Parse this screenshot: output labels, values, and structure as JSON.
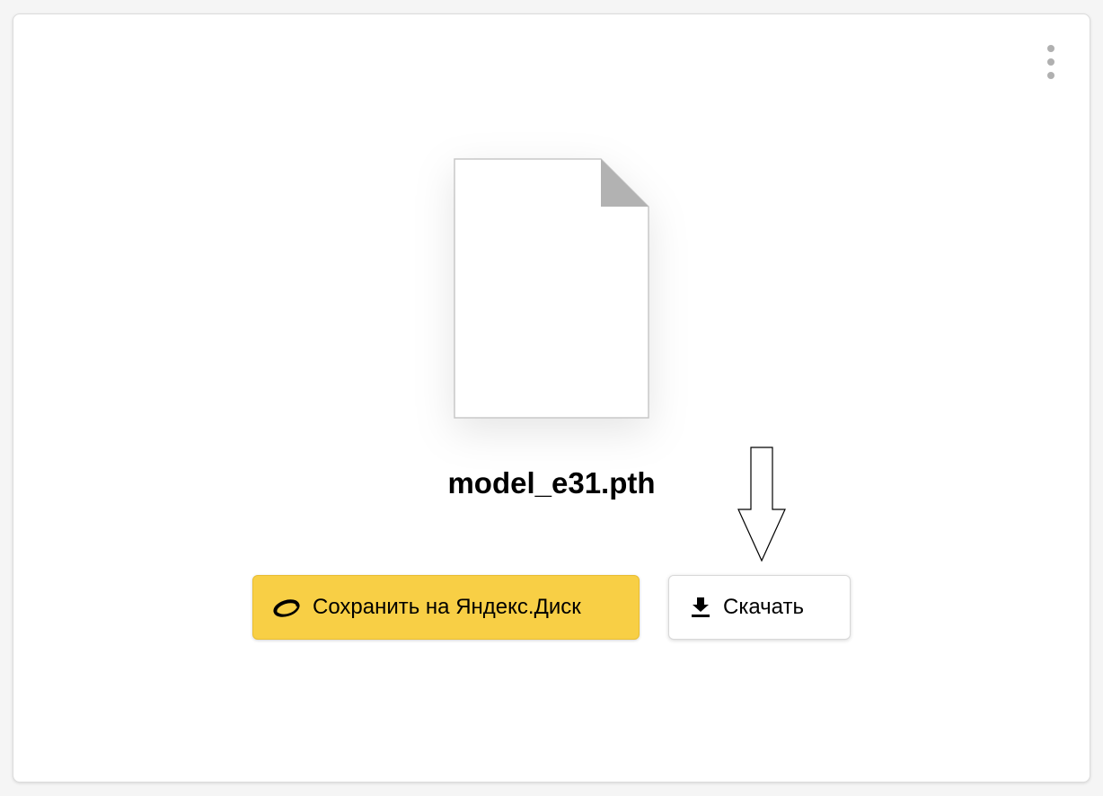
{
  "file": {
    "name": "model_e31.pth",
    "icon": "file-icon"
  },
  "actions": {
    "save_label": "Сохранить на Яндекс.Диск",
    "download_label": "Скачать"
  },
  "menu": {
    "icon": "more-vertical-icon"
  },
  "colors": {
    "save_button": "#f8cf45",
    "background": "#f5f5f5",
    "card": "#ffffff"
  }
}
